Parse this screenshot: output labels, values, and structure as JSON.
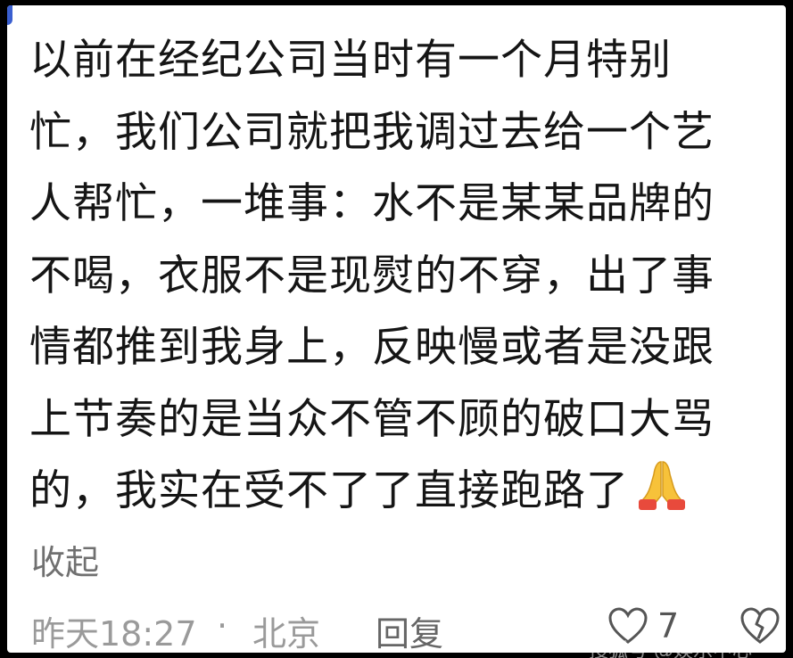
{
  "comment": {
    "lines": [
      "以前在经纪公司当时有一个月特别",
      "忙，我们公司就把我调过去给一个艺",
      "人帮忙，一堆事：水不是某某品牌的",
      "不喝，衣服不是现熨的不穿，出了事",
      "情都推到我身上，反映慢或者是没跟",
      "上节奏的是当众不管不顾的破口大骂",
      "的，我实在受不了了直接跑路了"
    ],
    "trailing_emoji": "folded-hands-icon",
    "collapse_label": "收起"
  },
  "meta": {
    "time": "昨天18:27",
    "separator": "·",
    "location": "北京",
    "reply_label": "回复",
    "like_count": "7"
  },
  "watermark": "搜狐号 @娱乐中心"
}
